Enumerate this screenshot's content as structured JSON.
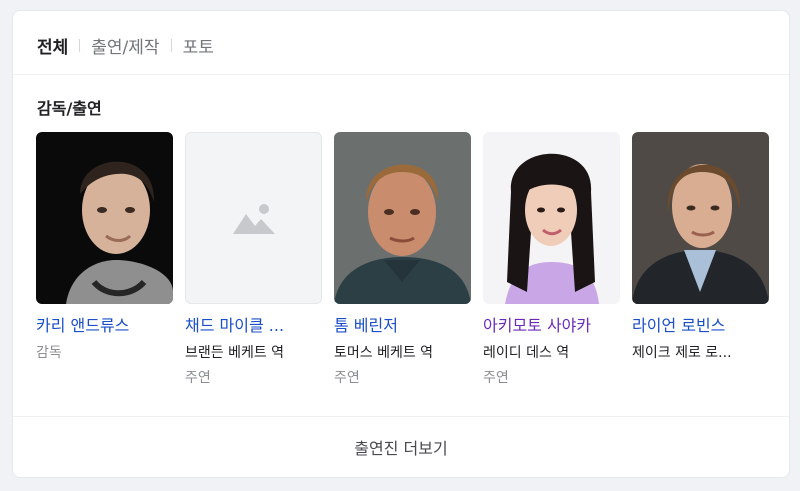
{
  "tabs": [
    {
      "label": "전체"
    },
    {
      "label": "출연/제작"
    },
    {
      "label": "포토"
    }
  ],
  "section_title": "감독/출연",
  "people": [
    {
      "name": "카리 앤드류스",
      "role": "",
      "type": "감독",
      "image": "photo"
    },
    {
      "name": "채드 마이클 ...",
      "role": "브랜든 베케트 역",
      "type": "주연",
      "image": "placeholder-icon"
    },
    {
      "name": "톰 베린저",
      "role": "토머스 베케트 역",
      "type": "주연",
      "image": "photo"
    },
    {
      "name": "아키모토 사야카",
      "role": "레이디 데스 역",
      "type": "주연",
      "image": "photo"
    },
    {
      "name": "라이언 로빈스",
      "role": "제이크 제로 로...",
      "type": "",
      "image": "photo"
    }
  ],
  "more_button": "출연진 더보기",
  "colors": {
    "link": "#1a4fc9",
    "background": "#f0f2f5",
    "card": "#ffffff"
  }
}
